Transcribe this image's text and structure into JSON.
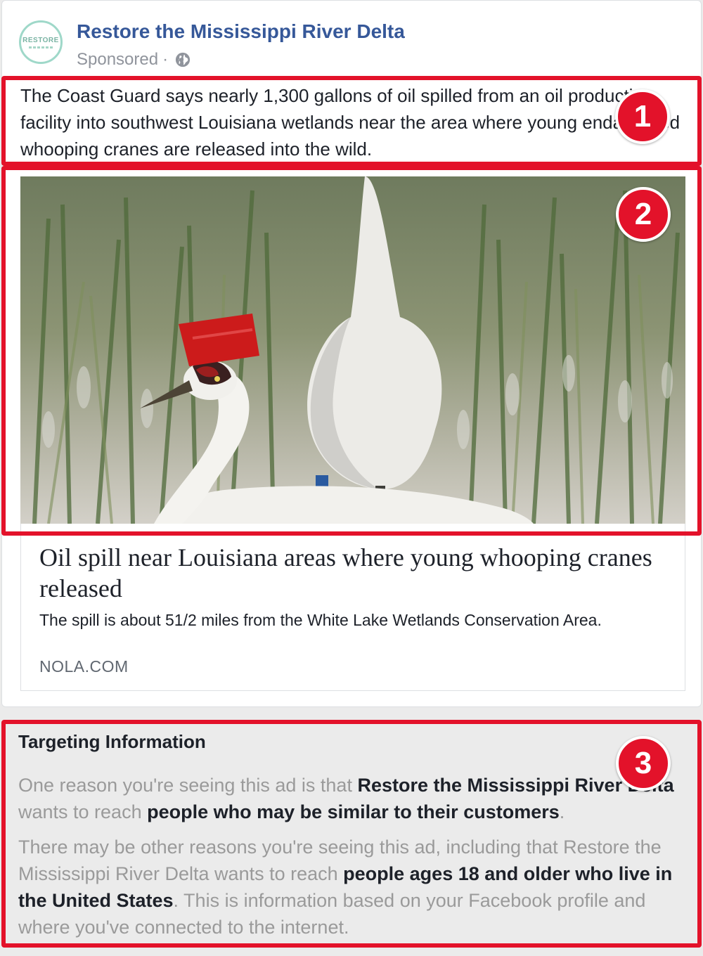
{
  "post": {
    "page_name": "Restore the Mississippi River Delta",
    "avatar_text": "RESTORE",
    "sponsored_label": "Sponsored",
    "separator": "·",
    "privacy_icon": "globe-icon",
    "text": "The Coast Guard says nearly 1,300 gallons of oil spilled from an oil production facility into southwest Louisiana wetlands near the area where young endangered whooping cranes are released into the wild."
  },
  "media": {
    "image_subject": "whooping-cranes-in-marsh"
  },
  "link": {
    "title": "Oil spill near Louisiana areas where young whooping cranes released",
    "description": "The spill is about 51/2 miles from the White Lake Wetlands Conservation Area.",
    "domain": "NOLA.COM"
  },
  "targeting": {
    "title": "Targeting Information",
    "p1": {
      "a": "One reason you're seeing this ad is that ",
      "b": "Restore the Mississippi River Delta",
      "c": " wants to reach ",
      "d": "people who may be similar to their customers",
      "e": "."
    },
    "p2": {
      "a": "There may be other reasons you're seeing this ad, including that Restore the Mississippi River Delta wants to reach ",
      "b": "people ages 18 and older who live in the United States",
      "c": ". This is information based on your Facebook profile and where you've connected to the internet."
    }
  },
  "annotations": {
    "badge_1": "1",
    "badge_2": "2",
    "badge_3": "3",
    "color": "#e3122a"
  },
  "colors": {
    "page_name": "#365899",
    "meta": "#90949c",
    "body_text": "#1d2129",
    "muted_text": "#9a9a9a"
  }
}
